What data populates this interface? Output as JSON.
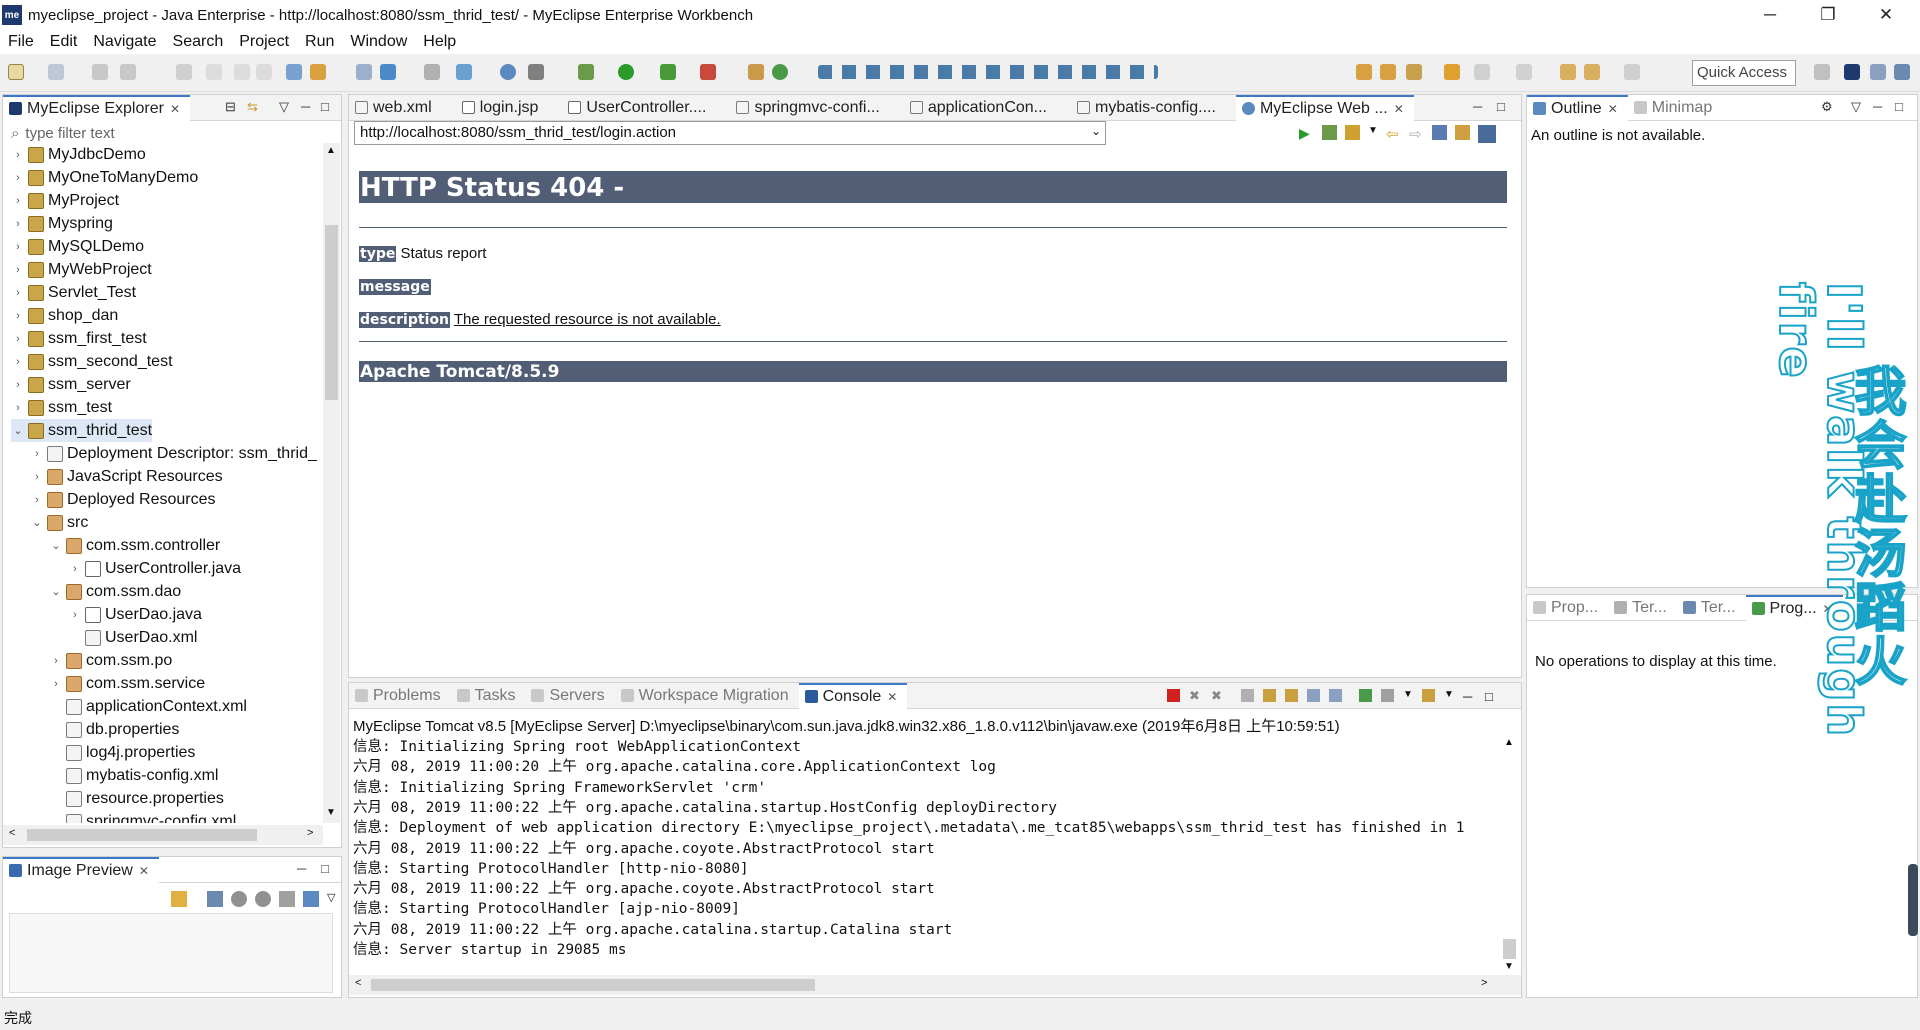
{
  "window": {
    "title": "myeclipse_project - Java Enterprise - http://localhost:8080/ssm_thrid_test/ - MyEclipse Enterprise Workbench",
    "logo": "me",
    "buttons": {
      "minimize": "─",
      "restore": "❐",
      "close": "✕"
    }
  },
  "menu": [
    "File",
    "Edit",
    "Navigate",
    "Search",
    "Project",
    "Run",
    "Window",
    "Help"
  ],
  "toolbar": {
    "quick_access_placeholder": "Quick Access"
  },
  "explorer": {
    "tab_label": "MyEclipse Explorer",
    "filter_placeholder": "type filter text",
    "items": [
      {
        "label": "MyJdbcDemo"
      },
      {
        "label": "MyOneToManyDemo"
      },
      {
        "label": "MyProject"
      },
      {
        "label": "Myspring"
      },
      {
        "label": "MySQLDemo"
      },
      {
        "label": "MyWebProject"
      },
      {
        "label": "Servlet_Test"
      },
      {
        "label": "shop_dan"
      },
      {
        "label": "ssm_first_test"
      },
      {
        "label": "ssm_second_test"
      },
      {
        "label": "ssm_server"
      },
      {
        "label": "ssm_test"
      },
      {
        "label": "ssm_thrid_test"
      },
      {
        "label": "Deployment Descriptor: ssm_thrid_"
      },
      {
        "label": "JavaScript Resources"
      },
      {
        "label": "Deployed Resources"
      },
      {
        "label": "src"
      },
      {
        "label": "com.ssm.controller"
      },
      {
        "label": "UserController.java"
      },
      {
        "label": "com.ssm.dao"
      },
      {
        "label": "UserDao.java"
      },
      {
        "label": "UserDao.xml"
      },
      {
        "label": "com.ssm.po"
      },
      {
        "label": "com.ssm.service"
      },
      {
        "label": "applicationContext.xml"
      },
      {
        "label": "db.properties"
      },
      {
        "label": "log4j.properties"
      },
      {
        "label": "mybatis-config.xml"
      },
      {
        "label": "resource.properties"
      },
      {
        "label": "springmvc-config.xml"
      }
    ]
  },
  "image_preview": {
    "tab_label": "Image Preview"
  },
  "editor": {
    "tabs": [
      {
        "label": "web.xml"
      },
      {
        "label": "login.jsp"
      },
      {
        "label": "UserController...."
      },
      {
        "label": "springmvc-confi..."
      },
      {
        "label": "applicationCon..."
      },
      {
        "label": "mybatis-config...."
      },
      {
        "label": "MyEclipse Web ..."
      }
    ],
    "url": "http://localhost:8080/ssm_thrid_test/login.action",
    "page": {
      "heading": "HTTP Status 404 -",
      "type_label": "type",
      "type_value": "Status report",
      "message_label": "message",
      "description_label": "description",
      "description_value": "The requested resource is not available.",
      "footer": "Apache Tomcat/8.5.9"
    }
  },
  "outline": {
    "tabs": [
      {
        "label": "Outline"
      },
      {
        "label": "Minimap"
      }
    ],
    "message": "An outline is not available."
  },
  "operations": {
    "tabs": [
      {
        "label": "Prop..."
      },
      {
        "label": "Ter..."
      },
      {
        "label": "Ter..."
      },
      {
        "label": "Prog..."
      }
    ],
    "message": "No operations to display at this time."
  },
  "console": {
    "tabs": [
      {
        "label": "Problems"
      },
      {
        "label": "Tasks"
      },
      {
        "label": "Servers"
      },
      {
        "label": "Workspace Migration"
      },
      {
        "label": "Console"
      }
    ],
    "header": "MyEclipse Tomcat v8.5 [MyEclipse Server] D:\\myeclipse\\binary\\com.sun.java.jdk8.win32.x86_1.8.0.v112\\bin\\javaw.exe (2019年6月8日 上午10:59:51)",
    "lines": [
      "信息: Initializing Spring root WebApplicationContext",
      "六月 08, 2019 11:00:20 上午 org.apache.catalina.core.ApplicationContext log",
      "信息: Initializing Spring FrameworkServlet 'crm'",
      "六月 08, 2019 11:00:22 上午 org.apache.catalina.startup.HostConfig deployDirectory",
      "信息: Deployment of web application directory E:\\myeclipse_project\\.metadata\\.me_tcat85\\webapps\\ssm_thrid_test has finished in 1",
      "六月 08, 2019 11:00:22 上午 org.apache.coyote.AbstractProtocol start",
      "信息: Starting ProtocolHandler [http-nio-8080]",
      "六月 08, 2019 11:00:22 上午 org.apache.coyote.AbstractProtocol start",
      "信息: Starting ProtocolHandler [ajp-nio-8009]",
      "六月 08, 2019 11:00:22 上午 org.apache.catalina.startup.Catalina start",
      "信息: Server startup in 29085 ms"
    ]
  },
  "overlay": {
    "english": "I'll walk through fire",
    "chinese": "我会赴汤蹈火"
  },
  "status": {
    "text": "完成"
  },
  "colors": {
    "accent": "#3c78c8",
    "tomcat_header": "#525d76",
    "overlay_stroke": "#1aa3c8"
  }
}
